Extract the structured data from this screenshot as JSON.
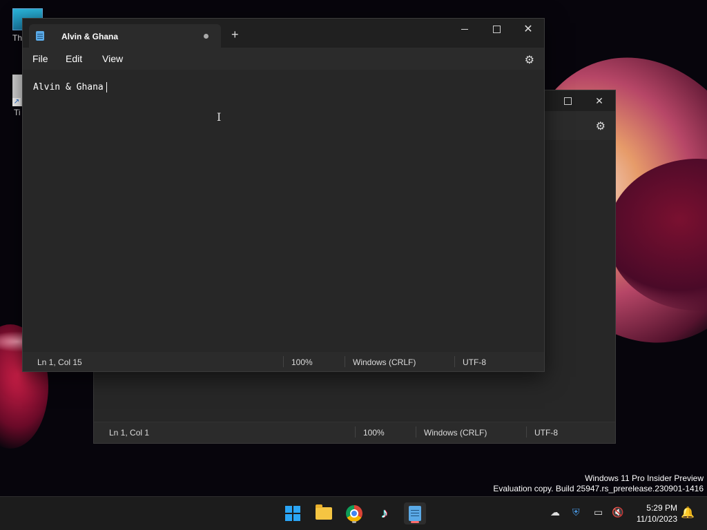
{
  "desktop": {
    "icon1_label": "Th",
    "icon2_label": "Ti"
  },
  "back_window": {
    "status": {
      "position": "Ln 1, Col 1",
      "zoom": "100%",
      "line_ending": "Windows (CRLF)",
      "encoding": "UTF-8"
    }
  },
  "window": {
    "tab_title": "Alvin & Ghana",
    "new_tab": "+",
    "menu": {
      "file": "File",
      "edit": "Edit",
      "view": "View"
    },
    "editor_text": "Alvin & Ghana",
    "status": {
      "position": "Ln 1, Col 15",
      "zoom": "100%",
      "line_ending": "Windows (CRLF)",
      "encoding": "UTF-8"
    }
  },
  "watermark": {
    "line1": "Windows 11 Pro Insider Preview",
    "line2": "Evaluation copy. Build 25947.rs_prerelease.230901-1416"
  },
  "taskbar": {
    "time": "5:29 PM",
    "date": "11/10/2023",
    "accent": "#ff6b6b"
  }
}
